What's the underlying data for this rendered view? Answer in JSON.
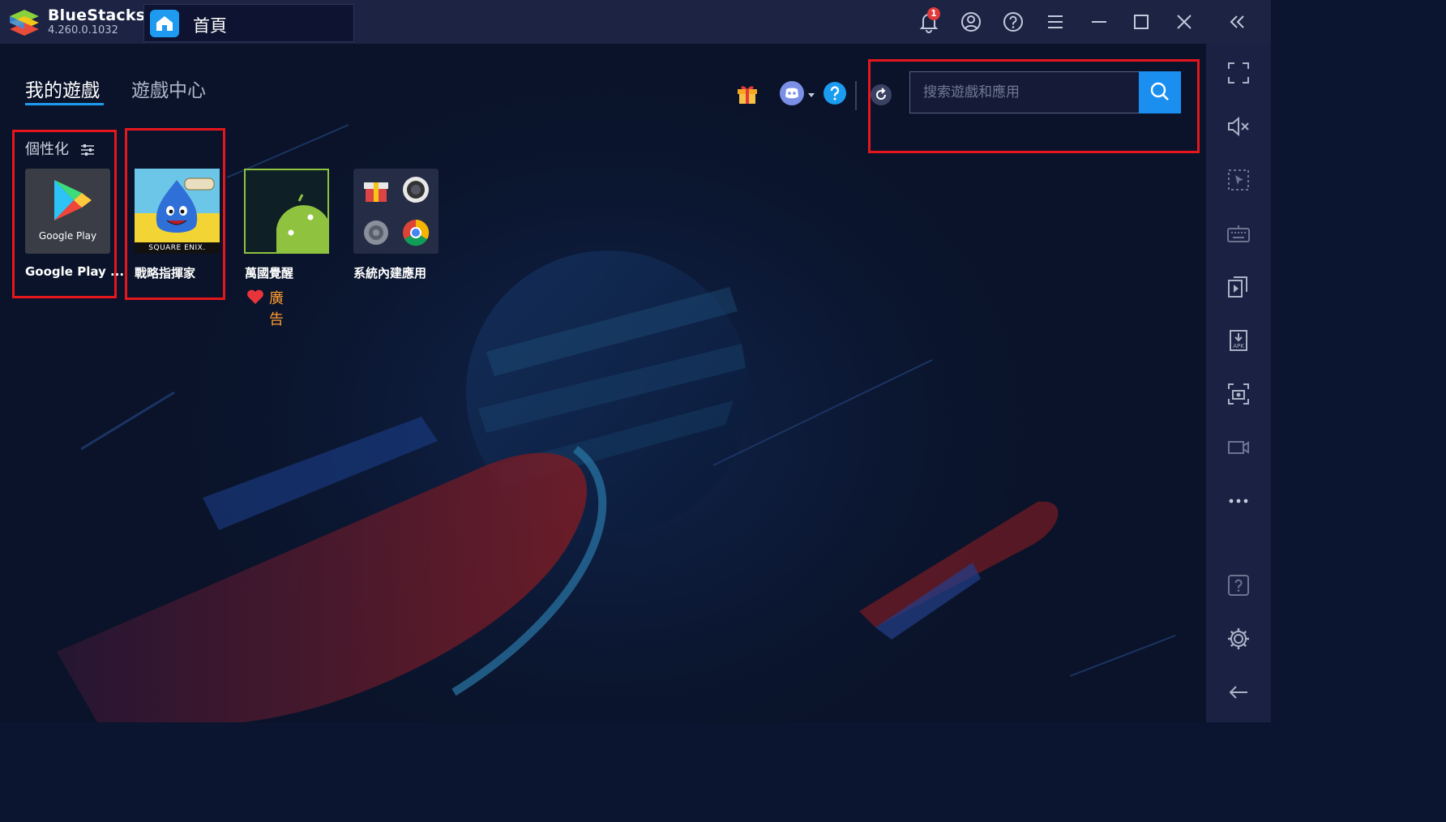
{
  "app": {
    "name": "BlueStacks",
    "version": "4.260.0.1032"
  },
  "window_tab": {
    "label": "首頁"
  },
  "titlebar": {
    "notification_count": "1"
  },
  "tabs": [
    {
      "label": "我的遊戲",
      "active": true
    },
    {
      "label": "遊戲中心",
      "active": false
    }
  ],
  "search": {
    "placeholder": "搜索遊戲和應用",
    "value": ""
  },
  "personalize": {
    "label": "個性化"
  },
  "apps": [
    {
      "label": "Google Play ...",
      "icon_text": "Google Play"
    },
    {
      "label": "戰略指揮家",
      "icon_text": "SQUARE ENIX."
    },
    {
      "label": "萬國覺醒",
      "ad_label": "廣告"
    },
    {
      "label": "系統內建應用"
    }
  ],
  "colors": {
    "accent": "#1a8ff0",
    "highlight": "#e5161d",
    "ad": "#ff9b2f",
    "background": "#0b1530"
  }
}
